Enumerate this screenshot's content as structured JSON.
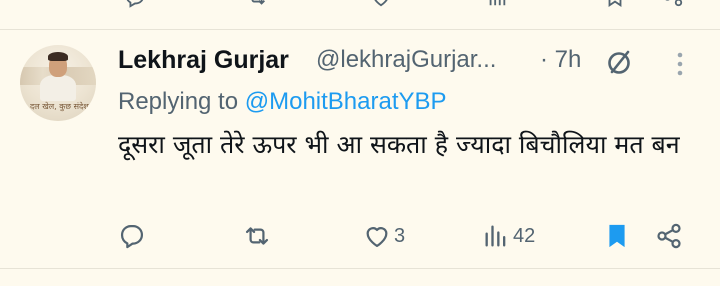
{
  "tweet": {
    "display_name": "Lekhraj Gurjar",
    "handle": "@lekhrajGurjar...",
    "time": "· 7h",
    "reply_prefix": "Replying to",
    "reply_to": "@MohitBharatYBP",
    "text": "दूसरा जूता तेरे ऊपर भी आ सकता है ज्यादा बिचौलिया मत बन",
    "avatar_caption": "दल खेल, कुछ संदेश"
  },
  "actions": {
    "reply_count": "",
    "retweet_count": "",
    "like_count": "3",
    "views_count": "42"
  },
  "colors": {
    "background": "#fefaee",
    "accent": "#1d9bf0",
    "muted": "#536471",
    "bookmark": "#1d9bf0"
  },
  "icons": [
    "grok-icon",
    "more-icon",
    "reply-icon",
    "retweet-icon",
    "like-icon",
    "views-icon",
    "bookmark-icon",
    "share-icon"
  ]
}
